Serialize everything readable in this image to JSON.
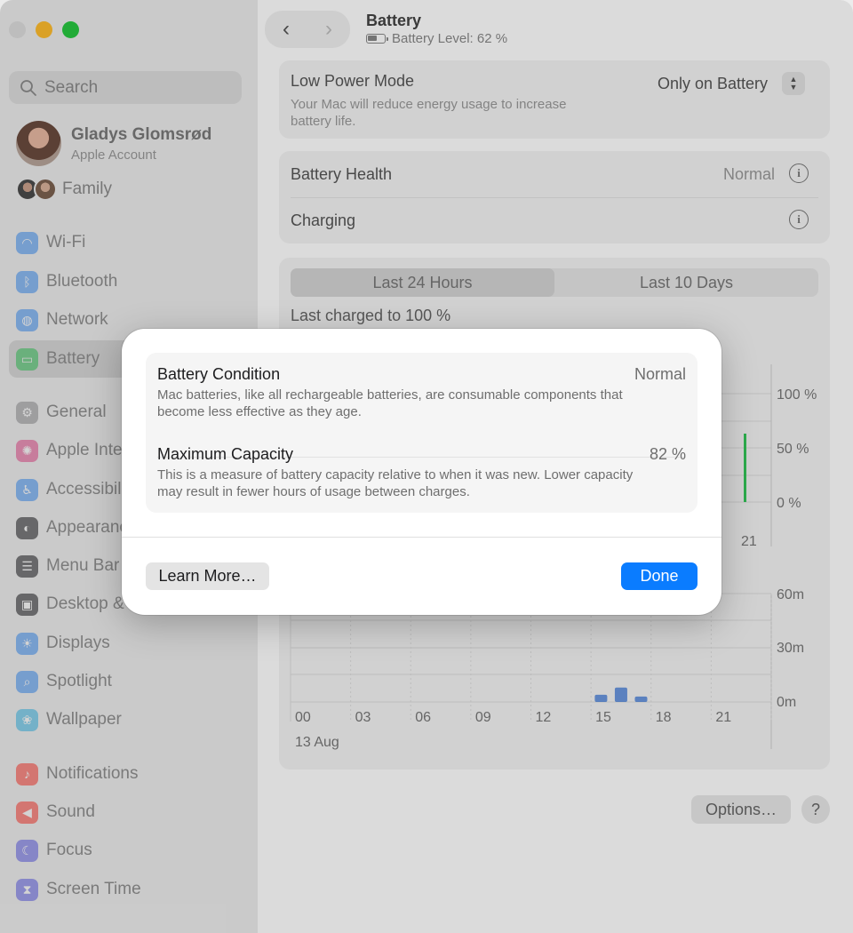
{
  "sidebar": {
    "search_placeholder": "Search",
    "account": {
      "name": "Gladys Glomsrød",
      "subtitle": "Apple Account"
    },
    "family_label": "Family",
    "items": [
      {
        "label": "Wi-Fi",
        "icon": "wifi-icon",
        "color": "#3b8ef5"
      },
      {
        "label": "Bluetooth",
        "icon": "bluetooth-icon",
        "color": "#3b8ef5"
      },
      {
        "label": "Network",
        "icon": "globe-icon",
        "color": "#3b8ef5"
      },
      {
        "label": "Battery",
        "icon": "battery-icon",
        "color": "#34c759"
      },
      {
        "label": "General",
        "icon": "gear-icon",
        "color": "#8e8e93"
      },
      {
        "label": "Apple Inte",
        "icon": "apple-intelligence-icon",
        "color": "#e64a8a"
      },
      {
        "label": "Accessibili",
        "icon": "accessibility-icon",
        "color": "#3b8ef5"
      },
      {
        "label": "Appearanc",
        "icon": "appearance-icon",
        "color": "#1d1d1f"
      },
      {
        "label": "Menu Bar",
        "icon": "menu-bar-icon",
        "color": "#1d1d1f"
      },
      {
        "label": "Desktop & D",
        "icon": "desktop-icon",
        "color": "#1d1d1f"
      },
      {
        "label": "Displays",
        "icon": "sun-icon",
        "color": "#3b8ef5"
      },
      {
        "label": "Spotlight",
        "icon": "magnifier-icon",
        "color": "#3b8ef5"
      },
      {
        "label": "Wallpaper",
        "icon": "flower-icon",
        "color": "#35b6e8"
      },
      {
        "label": "Notifications",
        "icon": "bell-icon",
        "color": "#ff3b30"
      },
      {
        "label": "Sound",
        "icon": "speaker-icon",
        "color": "#ff3b30"
      },
      {
        "label": "Focus",
        "icon": "moon-icon",
        "color": "#5e5ce6"
      },
      {
        "label": "Screen Time",
        "icon": "hourglass-icon",
        "color": "#5e5ce6"
      }
    ]
  },
  "header": {
    "title": "Battery",
    "subtitle": "Battery Level: 62 %"
  },
  "low_power": {
    "title": "Low Power Mode",
    "description": "Your Mac will reduce energy usage to increase battery life.",
    "value": "Only on Battery"
  },
  "health": {
    "battery_health_label": "Battery Health",
    "battery_health_value": "Normal",
    "charging_label": "Charging"
  },
  "usage": {
    "tabs": [
      "Last 24 Hours",
      "Last 10 Days"
    ],
    "last_charged": "Last charged to 100 %"
  },
  "chart_data": [
    {
      "type": "bar",
      "title": "",
      "y_ticks": [
        "100 %",
        "50 %",
        "0 %"
      ],
      "x_tick_visible": "21"
    },
    {
      "type": "bar",
      "title": "",
      "y_ticks": [
        "60m",
        "30m",
        "0m"
      ],
      "categories": [
        "00",
        "03",
        "06",
        "09",
        "12",
        "15",
        "18",
        "21"
      ],
      "x_date_label": "13 Aug",
      "ylim": [
        0,
        60
      ],
      "bars": [
        {
          "hour": 15.5,
          "value": 4
        },
        {
          "hour": 16.5,
          "value": 8
        },
        {
          "hour": 17.5,
          "value": 3
        }
      ],
      "bar_color": "#2f6fd6"
    }
  ],
  "footer": {
    "options_label": "Options…",
    "help_label": "?"
  },
  "modal": {
    "condition": {
      "title": "Battery Condition",
      "value": "Normal",
      "description": "Mac batteries, like all rechargeable batteries, are consumable components that become less effective as they age."
    },
    "capacity": {
      "title": "Maximum Capacity",
      "value": "82 %",
      "description": "This is a measure of battery capacity relative to when it was new. Lower capacity may result in fewer hours of usage between charges."
    },
    "learn_more_label": "Learn More…",
    "done_label": "Done",
    "accent_color": "#0a7cff"
  }
}
